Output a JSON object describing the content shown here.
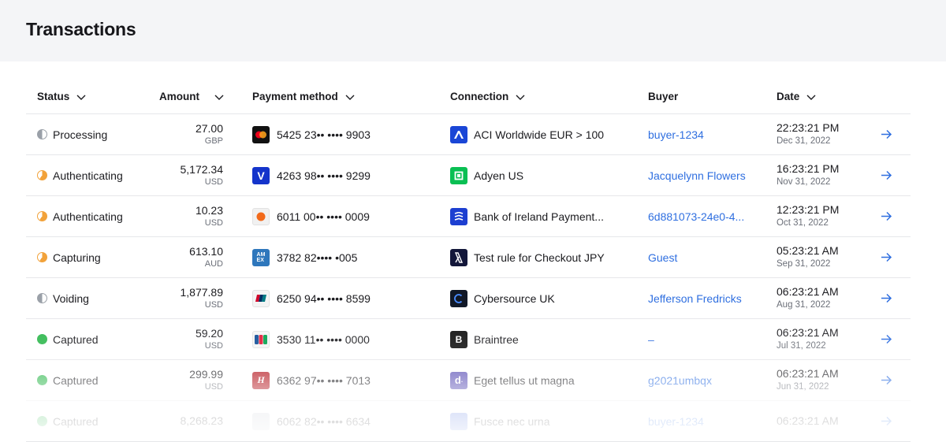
{
  "page": {
    "title": "Transactions"
  },
  "columns": {
    "status": "Status",
    "amount": "Amount",
    "payment_method": "Payment method",
    "connection": "Connection",
    "buyer": "Buyer",
    "date": "Date"
  },
  "rows": [
    {
      "status": "Processing",
      "status_color": "#9aa0a8",
      "amount": "27.00",
      "currency": "GBP",
      "card_icon": "mastercard-icon",
      "card": "5425 23•• •••• 9903",
      "connection_icon": "aci-worldwide-icon",
      "connection": "ACI Worldwide EUR > 100",
      "buyer": "buyer-1234",
      "time": "22:23:21 PM",
      "date": "Dec 31, 2022"
    },
    {
      "status": "Authenticating",
      "status_color": "#f2a23a",
      "amount": "5,172.34",
      "currency": "USD",
      "card_icon": "visa-icon",
      "card": "4263 98•• •••• 9299",
      "connection_icon": "adyen-icon",
      "connection": "Adyen US",
      "buyer": "Jacquelynn Flowers",
      "time": "16:23:21 PM",
      "date": "Nov 31, 2022"
    },
    {
      "status": "Authenticating",
      "status_color": "#f2a23a",
      "amount": "10.23",
      "currency": "USD",
      "card_icon": "discover-icon",
      "card": "6011 00•• •••• 0009",
      "connection_icon": "bank-of-ireland-icon",
      "connection": "Bank of Ireland Payment...",
      "buyer": "6d881073-24e0-4...",
      "time": "12:23:21 PM",
      "date": "Oct 31, 2022"
    },
    {
      "status": "Capturing",
      "status_color": "#f2a23a",
      "amount": "613.10",
      "currency": "AUD",
      "card_icon": "amex-icon",
      "card": "3782 82•••• •005",
      "connection_icon": "checkout-icon",
      "connection": "Test rule for Checkout JPY",
      "buyer": "Guest",
      "time": "05:23:21 AM",
      "date": "Sep 31, 2022"
    },
    {
      "status": "Voiding",
      "status_color": "#9aa0a8",
      "amount": "1,877.89",
      "currency": "USD",
      "card_icon": "unionpay-icon",
      "card": "6250 94•• •••• 8599",
      "connection_icon": "cybersource-icon",
      "connection": "Cybersource UK",
      "buyer": "Jefferson Fredricks",
      "time": "06:23:21 AM",
      "date": "Aug 31, 2022"
    },
    {
      "status": "Captured",
      "status_color": "#2fb84e",
      "amount": "59.20",
      "currency": "USD",
      "card_icon": "jcb-icon",
      "card": "3530 11•• •••• 0000",
      "connection_icon": "braintree-icon",
      "connection": "Braintree",
      "buyer": "–",
      "time": "06:23:21 AM",
      "date": "Jul 31, 2022"
    },
    {
      "status": "Captured",
      "status_color": "#2fb84e",
      "amount": "299.99",
      "currency": "USD",
      "card_icon": "hipercard-icon",
      "card": "6362 97•• •••• 7013",
      "connection_icon": "dlocal-icon",
      "connection": "Eget tellus ut magna",
      "buyer": "g2021umbqx",
      "time": "06:23:21 AM",
      "date": "Jun 31, 2022"
    },
    {
      "status": "Captured",
      "status_color": "#2fb84e",
      "amount": "8,268.23",
      "currency": "",
      "card_icon": "card-icon",
      "card": "6062 82•• •••• 6634",
      "connection_icon": "connection-icon",
      "connection": "Fusce nec urna",
      "buyer": "buyer-1234",
      "time": "06:23:21 AM",
      "date": ""
    }
  ],
  "colors": {
    "link": "#2f6fe0",
    "border": "#e6e7ea",
    "header_bg": "#f4f5f7"
  }
}
